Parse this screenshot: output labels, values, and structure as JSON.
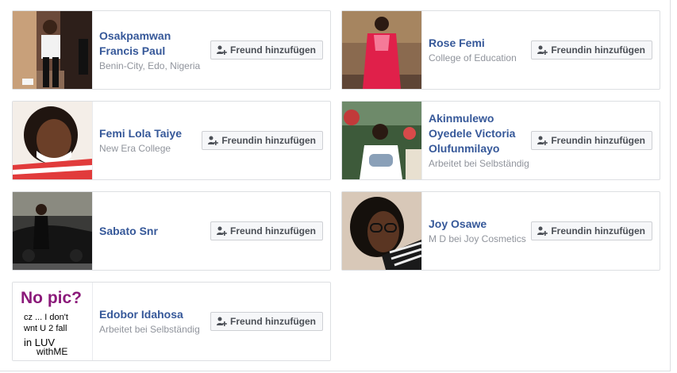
{
  "suggestions": [
    {
      "name": "Osakpamwan Francis Paul",
      "subtitle": "Benin-City, Edo, Nigeria",
      "button_label": "Freund hinzufügen",
      "photo": "man-in-white-shirt-photo"
    },
    {
      "name": "Rose Femi",
      "subtitle": "College of Education",
      "button_label": "Freundin hinzufügen",
      "photo": "woman-in-pink-dress-photo"
    },
    {
      "name": "Femi Lola Taiye",
      "subtitle": "New Era College",
      "button_label": "Freundin hinzufügen",
      "photo": "smiling-woman-selfie-photo"
    },
    {
      "name": "Akinmulewo Oyedele Victoria Olufunmilayo",
      "subtitle": "Arbeitet bei Selbständig",
      "button_label": "Freundin hinzufügen",
      "photo": "woman-holding-baby-photo"
    },
    {
      "name": "Sabato Snr",
      "subtitle": "",
      "button_label": "Freund hinzufügen",
      "photo": "man-with-car-photo"
    },
    {
      "name": "Joy Osawe",
      "subtitle": "M D bei Joy Cosmetics",
      "button_label": "Freundin hinzufügen",
      "photo": "woman-with-glasses-photo"
    },
    {
      "name": "Edobor Idahosa",
      "subtitle": "Arbeitet bei Selbständig",
      "button_label": "Freund hinzufügen",
      "photo": "no-pic-placeholder"
    }
  ],
  "nopic": {
    "line1": "No pic?",
    "line2": "cz ... I don't",
    "line3": "wnt U 2 fall",
    "line4": "in LUV",
    "line5": "withME"
  },
  "colors": {
    "name_link": "#365899",
    "subtitle": "#90949c",
    "button_bg": "#f6f7f9",
    "border": "#dddfe2"
  },
  "icons": {
    "add_friend": "add-friend-icon"
  }
}
